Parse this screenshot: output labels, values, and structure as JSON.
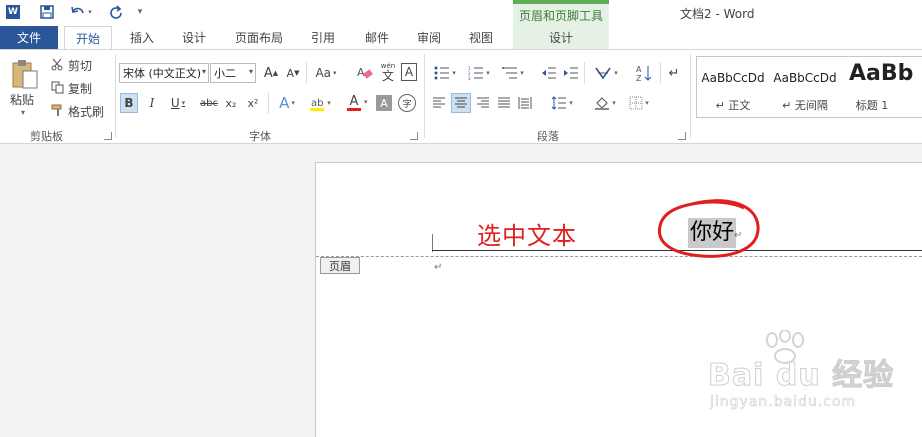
{
  "window": {
    "title": "文档2 - Word",
    "contextual_group": "页眉和页脚工具"
  },
  "quick_access": {
    "app_icon": "word-icon",
    "save_icon": "save-icon",
    "undo_icon": "undo-icon",
    "redo_icon": "redo-icon",
    "customize_icon": "customize-qat-icon"
  },
  "tabs": [
    {
      "label": "文件"
    },
    {
      "label": "开始"
    },
    {
      "label": "插入"
    },
    {
      "label": "设计"
    },
    {
      "label": "页面布局"
    },
    {
      "label": "引用"
    },
    {
      "label": "邮件"
    },
    {
      "label": "审阅"
    },
    {
      "label": "视图"
    },
    {
      "label": "设计"
    }
  ],
  "clipboard": {
    "label": "剪贴板",
    "paste": "粘贴",
    "cut": "剪切",
    "copy": "复制",
    "format_painter": "格式刷"
  },
  "font": {
    "label": "字体",
    "font_name": "宋体 (中文正文)",
    "font_size": "小二",
    "bold": "B",
    "italic": "I",
    "underline": "U",
    "strike": "abc",
    "subscript": "x₂",
    "superscript": "x²",
    "change_case": "Aa",
    "phonetic": "wén",
    "phonetic_char": "文",
    "border_char": "A",
    "text_effects": "A",
    "font_color": "A",
    "shading": "A",
    "enclose": "字",
    "grow": "A",
    "shrink": "A"
  },
  "paragraph": {
    "label": "段落"
  },
  "styles": [
    {
      "preview": "AaBbCcDd",
      "name": "↵ 正文"
    },
    {
      "preview": "AaBbCcDd",
      "name": "↵ 无间隔"
    },
    {
      "preview": "AaBb",
      "name": "标题 1"
    }
  ],
  "document": {
    "header_tag": "页眉",
    "annotation": "选中文本",
    "selected_text": "你好",
    "paragraph_mark": "↵"
  },
  "watermark": {
    "top": "Bai du 经验",
    "bottom": "jingyan.baidu.com"
  },
  "colors": {
    "accent": "#2b579a",
    "contextual": "#5fad56",
    "annotation": "#e02020",
    "highlight": "#c9c9c9"
  }
}
